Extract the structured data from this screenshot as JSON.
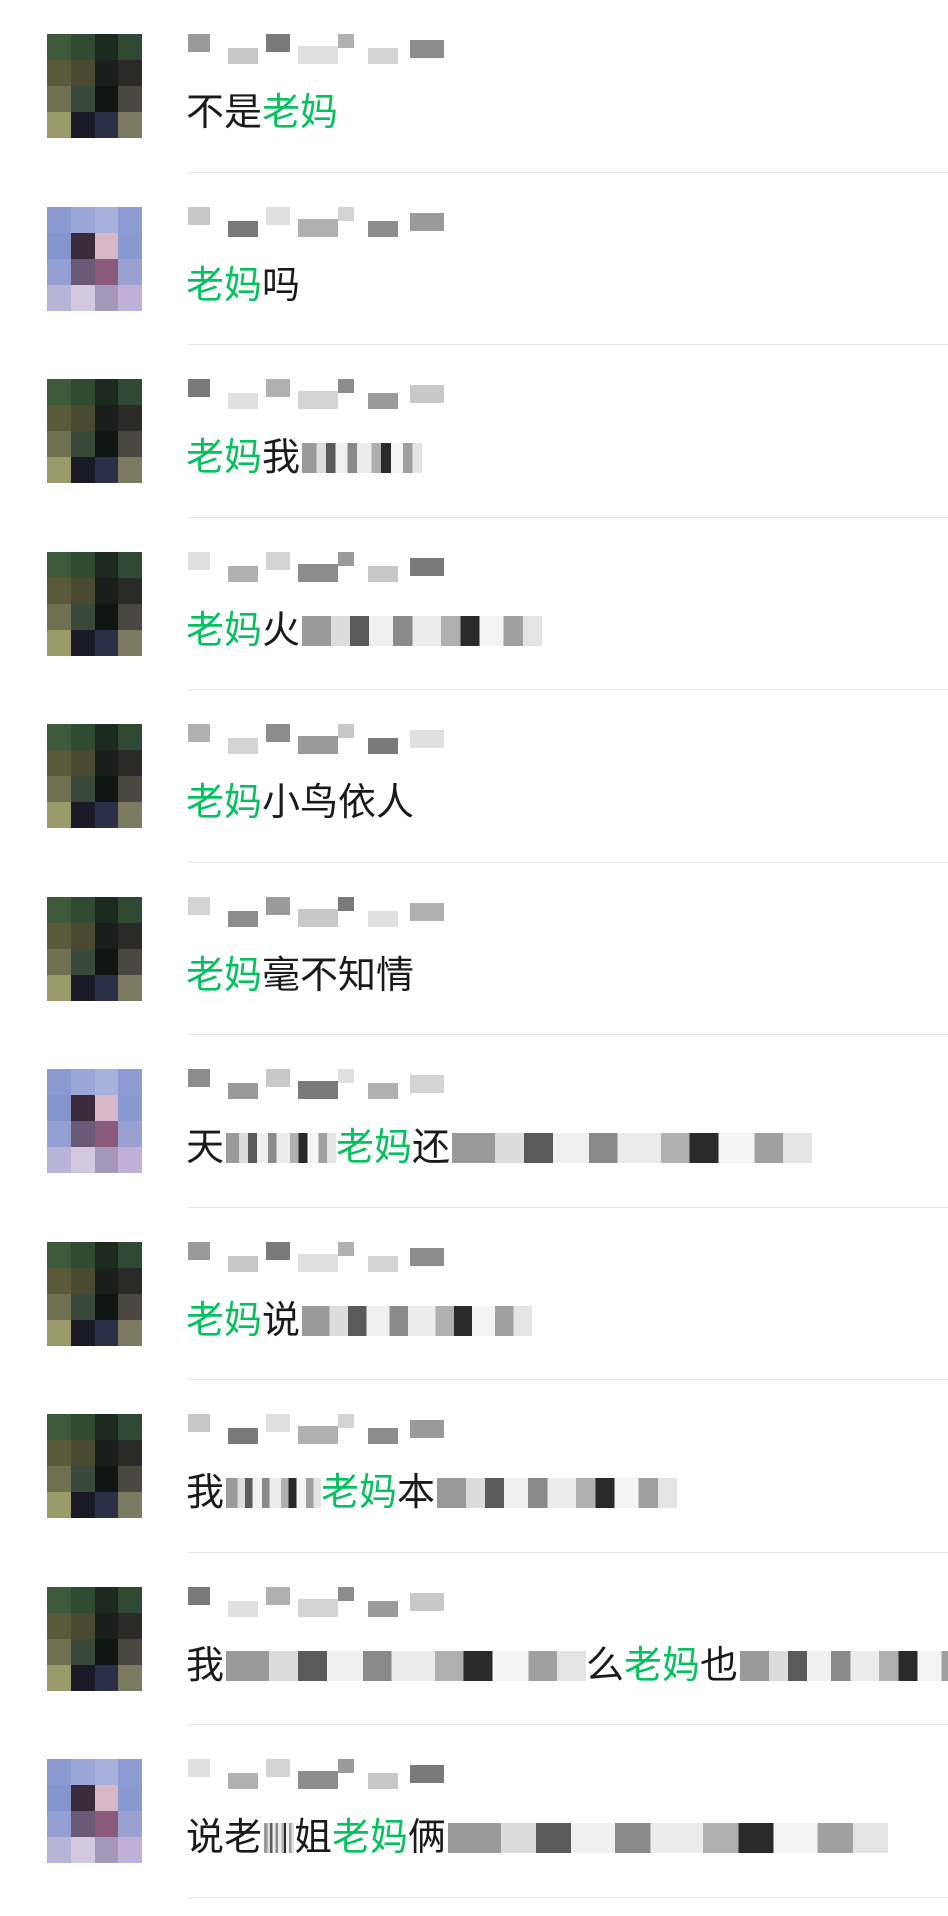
{
  "results": [
    {
      "avatar": "green",
      "before": "不是",
      "highlight": "老妈",
      "after": "",
      "blur": 0
    },
    {
      "avatar": "blue",
      "before": "",
      "highlight": "老妈",
      "after": "吗",
      "blur": 0
    },
    {
      "avatar": "green",
      "before": "",
      "highlight": "老妈",
      "after": "我",
      "blur": 120
    },
    {
      "avatar": "green",
      "before": "",
      "highlight": "老妈",
      "after": "火",
      "blur": 240
    },
    {
      "avatar": "green",
      "before": "",
      "highlight": "老妈",
      "after": "小鸟依人",
      "blur": 0
    },
    {
      "avatar": "green",
      "before": "",
      "highlight": "老妈",
      "after": "毫不知情",
      "blur": 0
    },
    {
      "avatar": "blue",
      "before": "天",
      "highlight": "老妈",
      "after": "还",
      "blur": 360,
      "lead_blur": 110
    },
    {
      "avatar": "green",
      "before": "",
      "highlight": "老妈",
      "after": "说",
      "blur": 230
    },
    {
      "avatar": "green",
      "before": "我",
      "highlight": "老妈",
      "after": "本",
      "blur": 240,
      "lead_blur": 95
    },
    {
      "avatar": "green",
      "before": "我",
      "highlight": "老妈",
      "after": "也",
      "blur": 240,
      "lead_blur": 360,
      "lead_tail": "么"
    },
    {
      "avatar": "blue",
      "before": "说老",
      "highlight": "老妈",
      "after": "俩",
      "blur": 440,
      "lead_blur": 30,
      "lead_tail": "姐"
    }
  ],
  "colors": {
    "highlight": "#07c160",
    "text": "#1a1a1a",
    "divider": "#e5e5e5"
  }
}
